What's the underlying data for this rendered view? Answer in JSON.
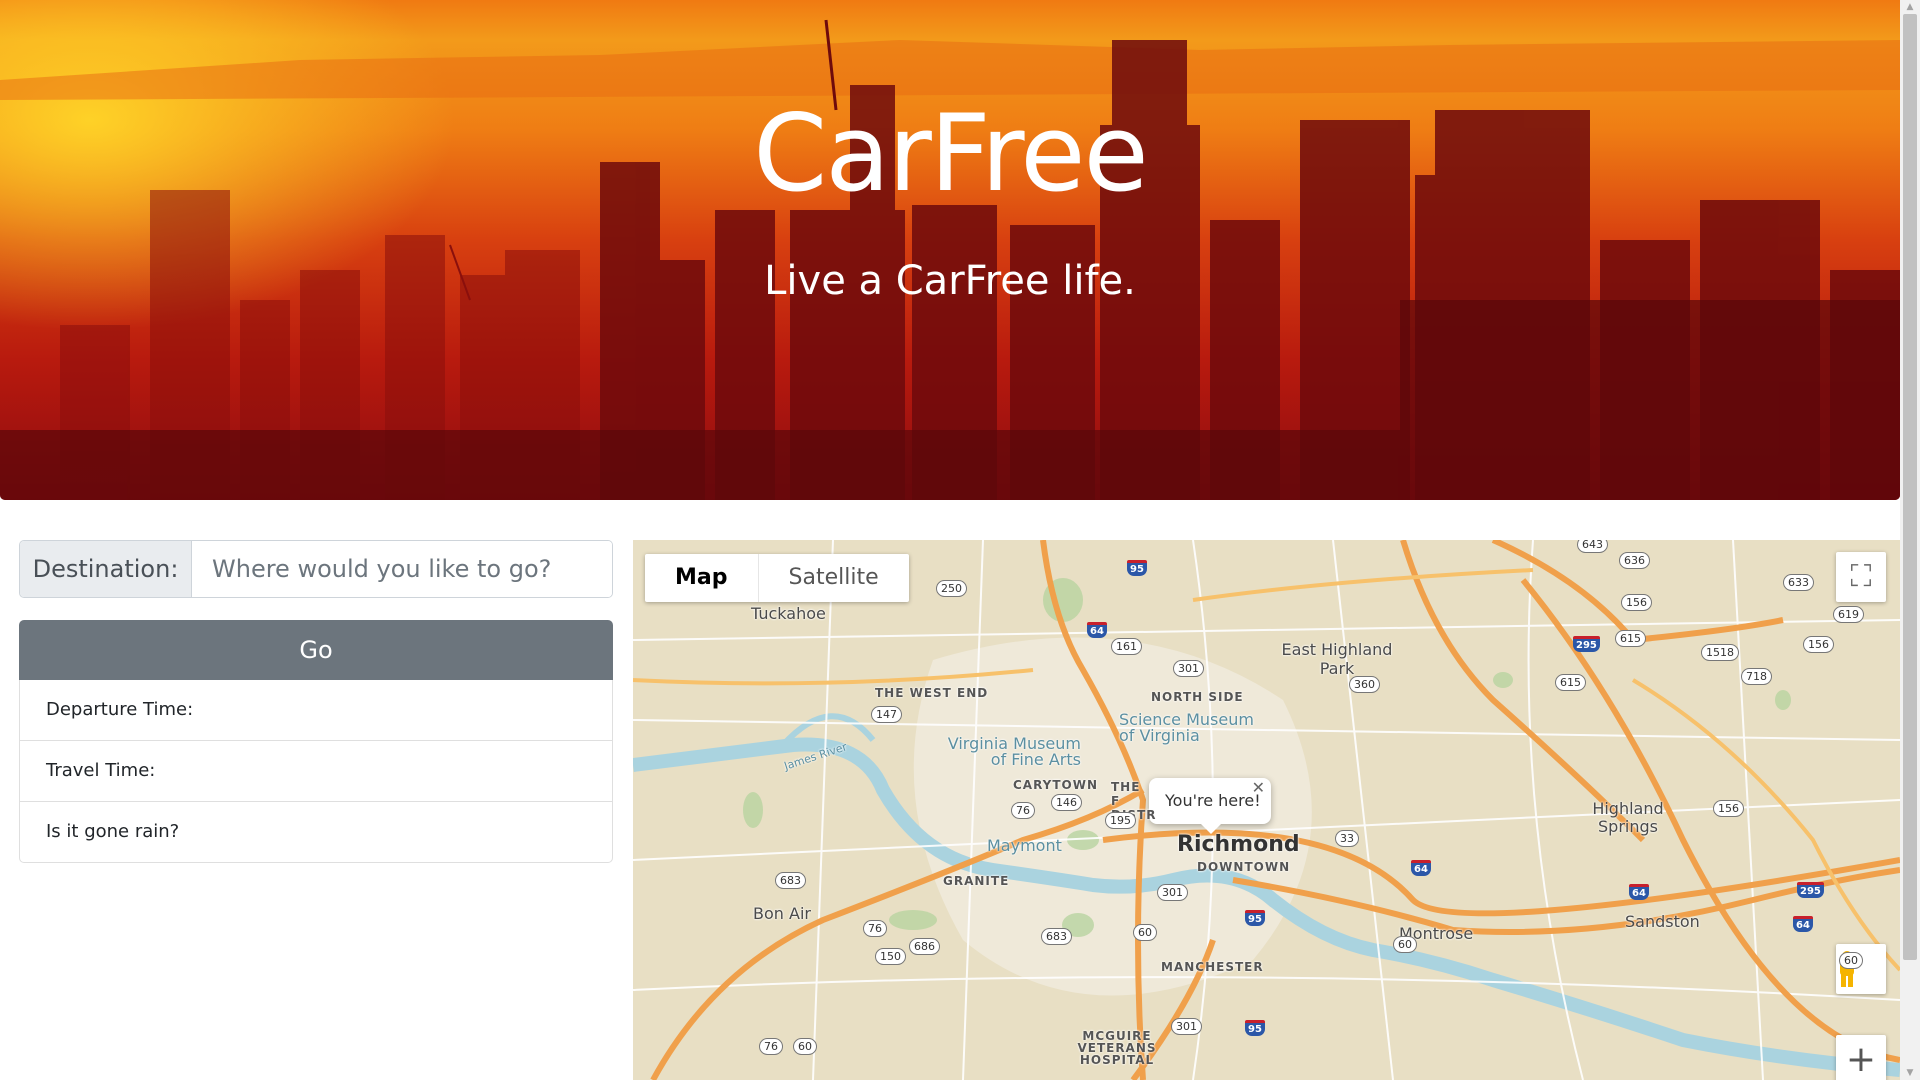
{
  "hero": {
    "title": "CarFree",
    "subtitle": "Live a CarFree life."
  },
  "form": {
    "destination_label": "Destination:",
    "destination_placeholder": "Where would you like to go?",
    "destination_value": "",
    "go_label": "Go",
    "info_items": [
      "Departure Time:",
      "Travel Time:",
      "Is it gone rain?"
    ]
  },
  "map": {
    "type_options": [
      "Map",
      "Satellite"
    ],
    "selected_type": "Map",
    "info_bubble": "You're here!",
    "labels": {
      "tuckahoe": "Tuckahoe",
      "east_highland_park": "East Highland Park",
      "the_west_end": "THE WEST END",
      "north_side": "NORTH SIDE",
      "science_museum": "Science Museum of Virginia",
      "vmfa": "Virginia Museum of Fine Arts",
      "carytown": "CARYTOWN",
      "the_fan": "THE F DISTR",
      "maymont": "Maymont",
      "richmond": "Richmond",
      "downtown": "DOWNTOWN",
      "granite": "GRANITE",
      "bon_air": "Bon Air",
      "manchester": "MANCHESTER",
      "mcguire": "MCGUIRE VETERANS HOSPITAL",
      "montrose": "Montrose",
      "sandston": "Sandston",
      "highland_springs": "Highland Springs",
      "james_river": "James River"
    },
    "shields": [
      "250",
      "161",
      "301",
      "360",
      "147",
      "146",
      "195",
      "76",
      "683",
      "301",
      "60",
      "686",
      "150",
      "76",
      "683",
      "60",
      "301",
      "33",
      "156",
      "615",
      "636",
      "643",
      "633",
      "619",
      "156",
      "1518",
      "718",
      "615",
      "156",
      "60",
      "76",
      "60"
    ],
    "interstates": [
      "95",
      "64",
      "295",
      "64",
      "95",
      "95",
      "64",
      "295",
      "64"
    ],
    "icons": [
      "fullscreen-icon",
      "pegman-icon",
      "zoom-in-icon",
      "close-icon"
    ]
  },
  "colors": {
    "go_button": "#6c757d",
    "input_addon": "#e9ecef",
    "map_land": "#e8dfc4",
    "map_water": "#aad3df",
    "highway": "#f0a04b"
  }
}
